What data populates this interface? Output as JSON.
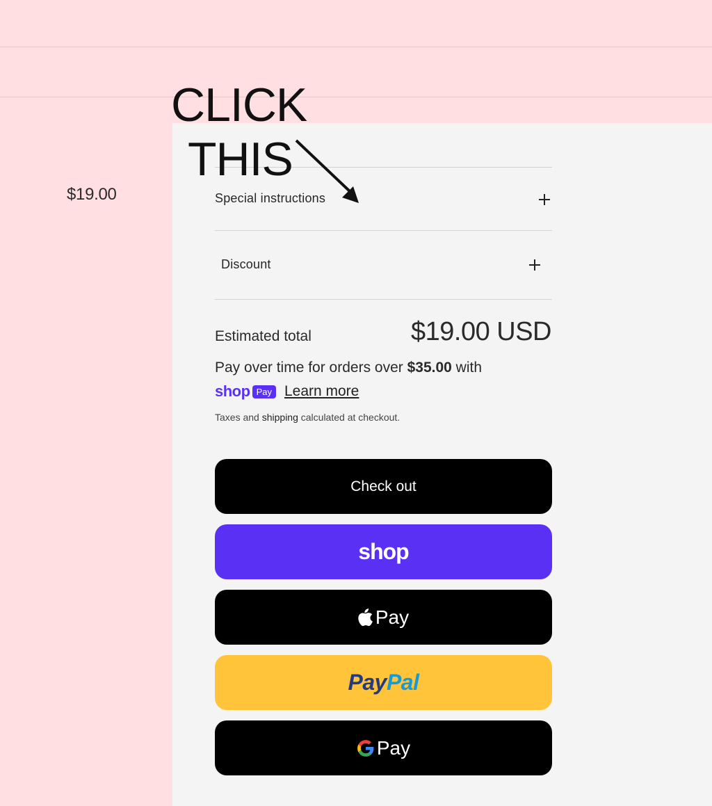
{
  "left_price": "$19.00",
  "annotation": {
    "line1": "CLICK",
    "line2": "THIS"
  },
  "cart": {
    "special_instructions_label": "Special instructions",
    "discount_label": "Discount",
    "estimated_total_label": "Estimated total",
    "estimated_total_value": "$19.00 USD",
    "pay_over_prefix": "Pay over time for orders over ",
    "pay_over_amount": "$35.00",
    "pay_over_suffix": " with",
    "shop_pay_word": "shop",
    "shop_pay_badge": "Pay",
    "learn_more": "Learn more",
    "taxes_prefix": "Taxes and ",
    "taxes_link": "shipping",
    "taxes_suffix": " calculated at checkout."
  },
  "buttons": {
    "checkout": "Check out",
    "shop": "shop",
    "apple_pay": "Pay",
    "paypal_part1": "Pay",
    "paypal_part2": "Pal",
    "google_pay": "Pay"
  },
  "icons": {
    "expand": "plus-icon",
    "apple": "apple-icon",
    "google": "google-g-icon",
    "annotation_arrow": "arrow-icon"
  },
  "colors": {
    "page_background": "#ffdfe2",
    "panel_background": "#f4f4f4",
    "shop_purple": "#5a31f4",
    "paypal_yellow": "#ffc439",
    "paypal_dark_blue": "#253b80",
    "paypal_light_blue": "#179bd7"
  }
}
